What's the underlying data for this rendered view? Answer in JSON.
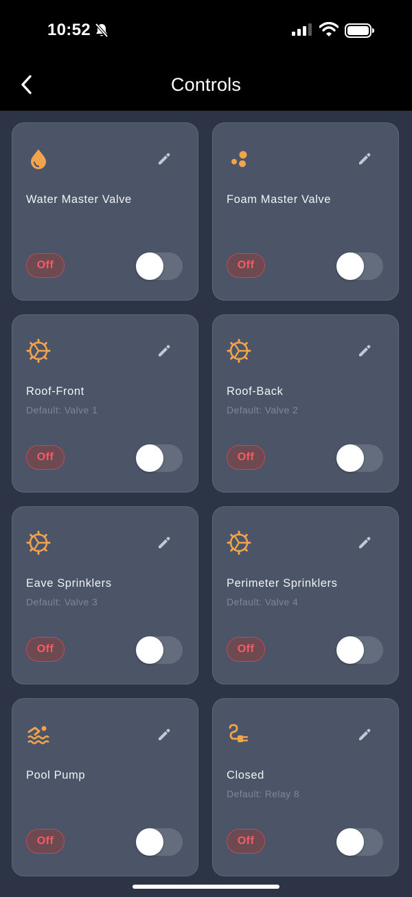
{
  "status_bar": {
    "time": "10:52"
  },
  "header": {
    "title": "Controls"
  },
  "colors": {
    "accent": "#f3a34c",
    "background": "#2c3446",
    "card": "#4b5567",
    "off_text": "#ff5a61"
  },
  "controls": [
    {
      "name": "Water Master Valve",
      "default": "",
      "state": "Off",
      "icon": "water-drop-icon"
    },
    {
      "name": "Foam Master Valve",
      "default": "",
      "state": "Off",
      "icon": "bubbles-icon"
    },
    {
      "name": "Roof-Front",
      "default": "Default: Valve 1",
      "state": "Off",
      "icon": "sprinkler-gear-icon"
    },
    {
      "name": "Roof-Back",
      "default": "Default: Valve 2",
      "state": "Off",
      "icon": "sprinkler-gear-icon"
    },
    {
      "name": "Eave Sprinklers",
      "default": "Default: Valve 3",
      "state": "Off",
      "icon": "sprinkler-gear-icon"
    },
    {
      "name": "Perimeter Sprinklers",
      "default": "Default: Valve 4",
      "state": "Off",
      "icon": "sprinkler-gear-icon"
    },
    {
      "name": "Pool Pump",
      "default": "",
      "state": "Off",
      "icon": "pool-swimmer-icon"
    },
    {
      "name": "Closed",
      "default": "Default: Relay 8",
      "state": "Off",
      "icon": "power-plug-icon"
    }
  ]
}
